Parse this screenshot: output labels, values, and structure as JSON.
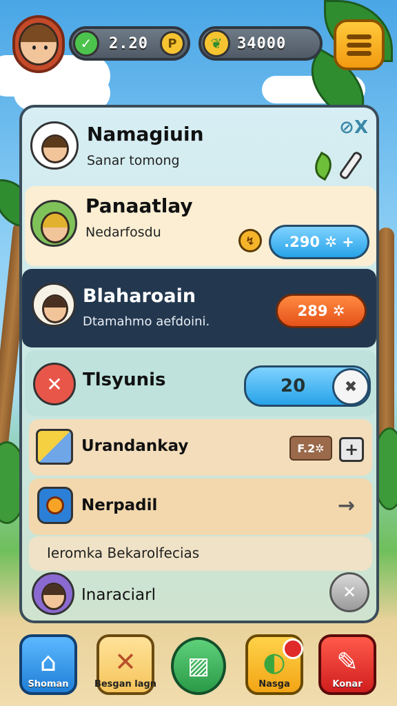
{
  "topbar": {
    "stat1_value": "2.20",
    "stat1_badge": "P",
    "stat2_value": "34000"
  },
  "panel": {
    "header": {
      "title": "Namagiuin",
      "subtitle": "Sanar tomong",
      "close": "⊘X"
    },
    "rows": [
      {
        "title": "Panaatlay",
        "subtitle": "Nedarfosdu",
        "value": ".290 ✲ +"
      },
      {
        "title": "Blaharoain",
        "subtitle": "Dtamahmo aefdoini.",
        "value": "289 ✲"
      },
      {
        "title": "Tlsyunis",
        "value": "20"
      },
      {
        "title": "Urandankay",
        "badge": "F.2✲"
      },
      {
        "title": "Nerpadil",
        "footer": "Ieromka Bekarolfecias"
      },
      {
        "title": "Inaraciarl"
      }
    ]
  },
  "nav": {
    "items": [
      {
        "label": "Shoman"
      },
      {
        "label": "Besgan lagn"
      },
      {
        "label": ""
      },
      {
        "label": "Nasga"
      },
      {
        "label": "Konar"
      }
    ]
  },
  "colors": {
    "accent_orange": "#f29a10",
    "accent_blue": "#27a3e8",
    "danger_red": "#e02a2a",
    "panel_dark": "#23384f"
  }
}
